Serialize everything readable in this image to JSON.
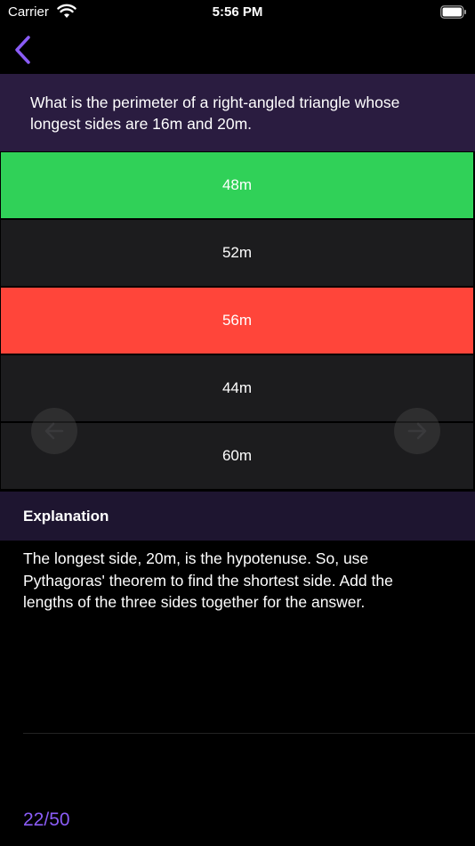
{
  "status_bar": {
    "carrier": "Carrier",
    "time": "5:56 PM"
  },
  "nav": {
    "back_icon": "chevron-left-icon",
    "accent_color": "#8a5cf6"
  },
  "question": {
    "text": "What is the perimeter of a right-angled triangle whose longest sides are 16m and 20m."
  },
  "answers": [
    {
      "label": "48m",
      "state": "correct"
    },
    {
      "label": "52m",
      "state": "neutral"
    },
    {
      "label": "56m",
      "state": "wrong"
    },
    {
      "label": "44m",
      "state": "neutral"
    },
    {
      "label": "60m",
      "state": "neutral"
    }
  ],
  "navigation_arrows": {
    "prev_icon": "arrow-left-icon",
    "next_icon": "arrow-right-icon"
  },
  "explanation": {
    "title": "Explanation",
    "body": "The longest side, 20m, is the hypotenuse. So, use Pythagoras' theorem to find the shortest side. Add the lengths of the three sides together for the answer."
  },
  "progress": {
    "text": "22/50"
  },
  "colors": {
    "correct": "#30d158",
    "wrong": "#ff453a",
    "neutral": "#1c1c1e",
    "question_bg": "#2a1c40"
  }
}
